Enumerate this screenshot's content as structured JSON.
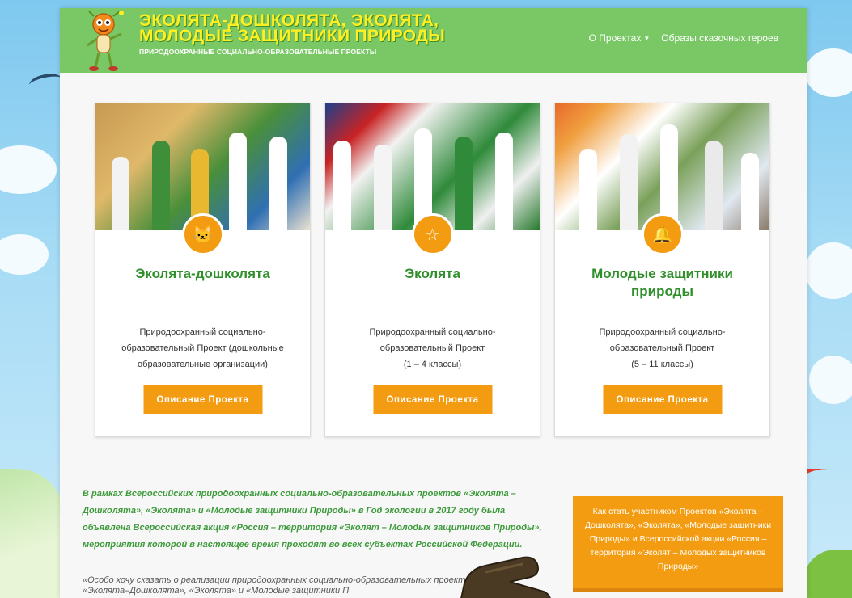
{
  "header": {
    "title_line1": "ЭКОЛЯТА-ДОШКОЛЯТА,  ЭКОЛЯТА,",
    "title_line2": "МОЛОДЫЕ ЗАЩИТНИКИ ПРИРОДЫ",
    "subtitle": "ПРИРОДООХРАННЫЕ СОЦИАЛЬНО-ОБРАЗОВАТЕЛЬНЫЕ ПРОЕКТЫ",
    "colors": {
      "bar": "#79c865",
      "title": "#ffef22"
    }
  },
  "nav": {
    "items": [
      {
        "label": "О Проектах",
        "has_dropdown": true,
        "caret_icon": "caret-down-icon"
      },
      {
        "label": "Образы сказочных героев",
        "has_dropdown": false
      }
    ]
  },
  "cards": [
    {
      "badge_icon": "mascot-face-icon",
      "badge_glyph": "🐱",
      "title": "Эколята-дошколята",
      "text": "Природоохранный социально-\nобразовательный Проект (дошкольные\nобразовательные организации)",
      "button": "Описание Проекта"
    },
    {
      "badge_icon": "star-icon",
      "badge_glyph": "☆",
      "title": "Эколята",
      "text": "Природоохранный социально-\nобразовательный Проект\n(1 – 4 классы)",
      "button": "Описание Проекта"
    },
    {
      "badge_icon": "bell-icon",
      "badge_glyph": "🔔",
      "title": "Молодые защитники природы",
      "text": "Природоохранный социально-\nобразовательный Проект\n(5 – 11 классы)",
      "button": "Описание Проекта"
    }
  ],
  "intro_text": "В рамках Всероссийских природоохранных социально-образовательных проектов «Эколята – Дошколята», «Эколята» и «Молодые защитники Природы» в Год экологии в 2017 году была объявлена Всероссийская акция «Россия – территория «Эколят – Молодых защитников Природы», мероприятия которой в настоящее время проходят во всех субъектах Российской Федерации.",
  "quote_text": "«Особо хочу сказать о реализации природоохранных социально-образовательных проектов «Эколята–Дошколята», «Эколята» и «Молодые защитники П",
  "join_box": {
    "text": "Как стать участником Проектов «Эколята – Дошколята», «Эколята», «Молодые защитники Природы» и Всероссийской акции «Россия – территория «Эколят – Молодых защитников Природы»"
  },
  "colors": {
    "accent_orange": "#f39c12",
    "title_green": "#2f8f2a",
    "intro_green": "#3c9a3a"
  }
}
